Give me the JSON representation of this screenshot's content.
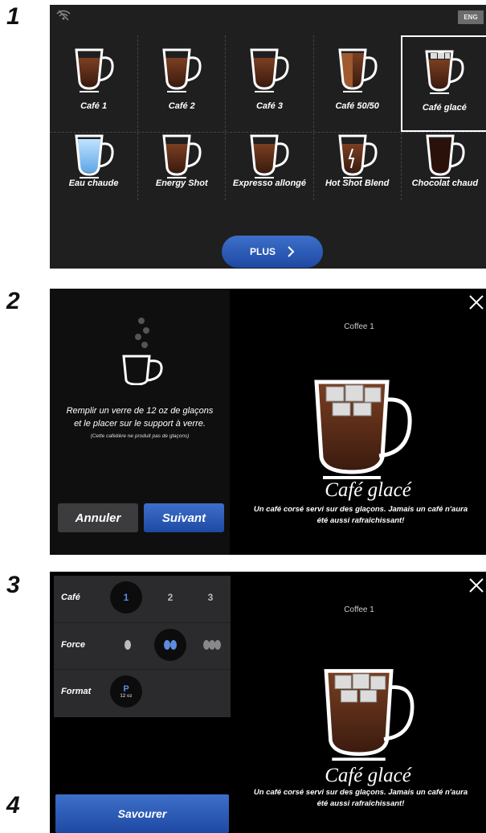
{
  "steps": {
    "one": "1",
    "two": "2",
    "three": "3",
    "four": "4"
  },
  "panel1": {
    "lang_label": "ENG",
    "row1": [
      "Café 1",
      "Café 2",
      "Café 3",
      "Café 50/50",
      "Café glacé"
    ],
    "row2": [
      "Eau chaude",
      "Energy Shot",
      "Expresso allongé",
      "Hot Shot Blend",
      "Chocolat chaud"
    ],
    "selected": "Café glacé",
    "more_label": "PLUS",
    "more_icon": "chevron-right-icon"
  },
  "panel2": {
    "instruction_line1": "Remplir un verre de 12 oz de glaçons",
    "instruction_line2": "et le placer sur le support à verre.",
    "instruction_note": "(Cette cafetière ne produit pas de glaçons)",
    "cancel_label": "Annuler",
    "next_label": "Suivant",
    "coffee_label": "Coffee 1",
    "drink_title": "Café glacé",
    "drink_desc_line1": "Un café corsé servi sur des glaçons. Jamais un café n'aura",
    "drink_desc_line2": "été aussi rafraîchissant!"
  },
  "panel3": {
    "cafe_label": "Café",
    "cafe_options": [
      "1",
      "2",
      "3"
    ],
    "cafe_selected": "1",
    "force_label": "Force",
    "force_selected_index": 2,
    "format_label": "Format",
    "format_value": "P",
    "format_size": "12 oz",
    "coffee_label": "Coffee 1",
    "drink_title": "Café glacé",
    "drink_desc_line1": "Un café corsé servi sur des glaçons. Jamais un café n'aura",
    "drink_desc_line2": "été aussi rafraîchissant!"
  },
  "savour_label": "Savourer",
  "colors": {
    "accent_blue": "#2a58b6",
    "panel_dark": "#1f1f20",
    "coffee": "#5b2e1c"
  }
}
